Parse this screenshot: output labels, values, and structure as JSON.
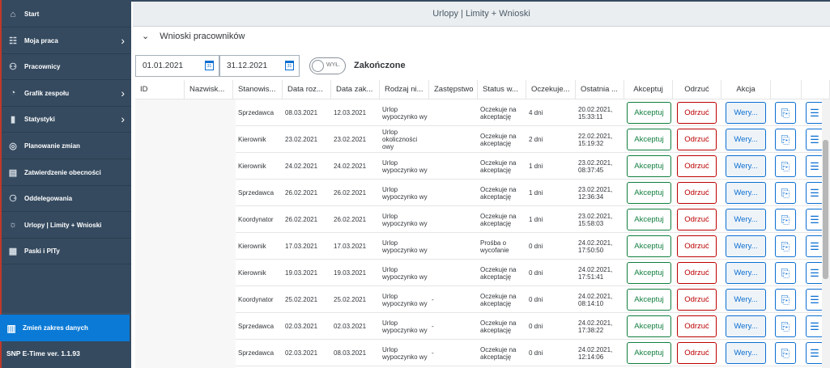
{
  "sidebar": {
    "items": [
      {
        "label": "Start",
        "icon": "home-icon",
        "glyph": "⌂",
        "chevron": false
      },
      {
        "label": "Moja praca",
        "icon": "briefcase-icon",
        "glyph": "☷",
        "chevron": true
      },
      {
        "label": "Pracownicy",
        "icon": "employees-icon",
        "glyph": "⚇",
        "chevron": false
      },
      {
        "label": "Grafik zespołu",
        "icon": "schedule-icon",
        "glyph": "◔",
        "chevron": true
      },
      {
        "label": "Statystyki",
        "icon": "bar-chart-icon",
        "glyph": "▮",
        "chevron": true
      },
      {
        "label": "Planowanie zmian",
        "icon": "shift-planning-icon",
        "glyph": "◎",
        "chevron": false
      },
      {
        "label": "Zatwierdzenie obecności",
        "icon": "approval-icon",
        "glyph": "▤",
        "chevron": false
      },
      {
        "label": "Oddelegowania",
        "icon": "delegation-icon",
        "glyph": "⚆",
        "chevron": false
      },
      {
        "label": "Urlopy | Limity + Wnioski",
        "icon": "vacation-icon",
        "glyph": "☼",
        "chevron": false
      },
      {
        "label": "Paski i PITy",
        "icon": "payslip-icon",
        "glyph": "▦",
        "chevron": false
      }
    ],
    "change_range": {
      "label": "Zmień zakres danych",
      "icon": "building-icon",
      "glyph": "▥"
    },
    "version": "SNP E-Time ver. 1.1.93"
  },
  "header": {
    "title": "Urlopy | Limity + Wnioski"
  },
  "section": {
    "title": "Wnioski pracowników",
    "chevron": "⌄"
  },
  "filters": {
    "date_from": "01.01.2021",
    "date_to": "31.12.2021",
    "toggle_state": "WYŁ.",
    "toggle_label": "Zakończone"
  },
  "table": {
    "columns": [
      "ID",
      "Nazwisk...",
      "Stanowis...",
      "Data roz...",
      "Data zak...",
      "Rodzaj ni...",
      "Zastępstwo",
      "Status w...",
      "Oczekuje...",
      "Ostatnia ...",
      "Akceptuj",
      "Odrzuć",
      "Akcja",
      "",
      ""
    ],
    "accept_label": "Akceptuj",
    "reject_label": "Odrzuć",
    "more_label": "Wery...",
    "rows": [
      {
        "position": "Sprzedawca",
        "start": "08.03.2021",
        "end": "12.03.2021",
        "type": "Urlop wypoczynko wy",
        "substitute": "",
        "status": "Oczekuje na akceptację",
        "waiting": "4 dni",
        "last": "20.02.2021, 15:33:11"
      },
      {
        "position": "Kierownik",
        "start": "23.02.2021",
        "end": "23.02.2021",
        "type": "Urlop okoliczności owy",
        "substitute": "",
        "status": "Oczekuje na akceptację",
        "waiting": "2 dni",
        "last": "22.02.2021, 15:19:32"
      },
      {
        "position": "Kierownik",
        "start": "24.02.2021",
        "end": "24.02.2021",
        "type": "Urlop wypoczynko wy",
        "substitute": "",
        "status": "Oczekuje na akceptację",
        "waiting": "1 dni",
        "last": "23.02.2021, 08:37:45"
      },
      {
        "position": "Sprzedawca",
        "start": "26.02.2021",
        "end": "26.02.2021",
        "type": "Urlop wypoczynko wy",
        "substitute": "",
        "status": "Oczekuje na akceptację",
        "waiting": "1 dni",
        "last": "23.02.2021, 12:36:34"
      },
      {
        "position": "Koordynator",
        "start": "26.02.2021",
        "end": "26.02.2021",
        "type": "Urlop wypoczynko wy",
        "substitute": "",
        "status": "Oczekuje na akceptację",
        "waiting": "1 dni",
        "last": "23.02.2021, 15:58:03"
      },
      {
        "position": "Kierownik",
        "start": "17.03.2021",
        "end": "17.03.2021",
        "type": "Urlop wypoczynko wy",
        "substitute": "",
        "status": "Prośba o wycofanie",
        "waiting": "0 dni",
        "last": "24.02.2021, 17:50:50"
      },
      {
        "position": "Kierownik",
        "start": "19.03.2021",
        "end": "19.03.2021",
        "type": "Urlop wypoczynko wy",
        "substitute": "",
        "status": "Oczekuje na akceptację",
        "waiting": "0 dni",
        "last": "24.02.2021, 17:51:41"
      },
      {
        "position": "Koordynator",
        "start": "25.02.2021",
        "end": "25.02.2021",
        "type": "Urlop wypoczynko wy",
        "substitute": "-",
        "status": "Oczekuje na akceptację",
        "waiting": "0 dni",
        "last": "24.02.2021, 08:14:10"
      },
      {
        "position": "Sprzedawca",
        "start": "02.03.2021",
        "end": "02.03.2021",
        "type": "Urlop wypoczynko wy",
        "substitute": "-",
        "status": "Oczekuje na akceptację",
        "waiting": "0 dni",
        "last": "24.02.2021, 17:38:22"
      },
      {
        "position": "Sprzedawca",
        "start": "02.03.2021",
        "end": "08.03.2021",
        "type": "Urlop wypoczynko wy",
        "substitute": "-",
        "status": "Oczekuje na akceptację",
        "waiting": "0 dni",
        "last": "24.02.2021, 12:14:06"
      }
    ]
  },
  "colors": {
    "sidebar": "#354a5f",
    "accent": "#0a7ad6",
    "accept": "#107e3e",
    "reject": "#bb0000"
  }
}
